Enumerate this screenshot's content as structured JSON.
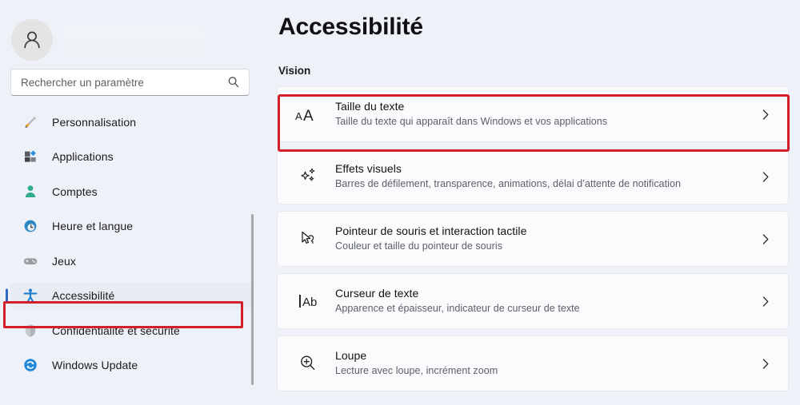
{
  "sidebar": {
    "avatar_icon": "person-avatar-icon",
    "search": {
      "placeholder": "Rechercher un paramètre",
      "value": "",
      "icon": "search-icon"
    },
    "items": [
      {
        "label": "Personnalisation",
        "icon": "paintbrush-icon",
        "selected": false
      },
      {
        "label": "Applications",
        "icon": "apps-grid-icon",
        "selected": false
      },
      {
        "label": "Comptes",
        "icon": "account-person-icon",
        "selected": false
      },
      {
        "label": "Heure et langue",
        "icon": "clock-globe-icon",
        "selected": false
      },
      {
        "label": "Jeux",
        "icon": "gamepad-icon",
        "selected": false
      },
      {
        "label": "Accessibilité",
        "icon": "accessibility-person-icon",
        "selected": true
      },
      {
        "label": "Confidentialité et sécurité",
        "icon": "shield-icon",
        "selected": false
      },
      {
        "label": "Windows Update",
        "icon": "sync-refresh-icon",
        "selected": false
      }
    ]
  },
  "main": {
    "title": "Accessibilité",
    "section": "Vision",
    "cards": [
      {
        "title": "Taille du texte",
        "subtitle": "Taille du texte qui apparaît dans Windows et vos applications",
        "icon": "text-size-aa-icon",
        "chevron": "chevron-right-icon",
        "highlighted": true
      },
      {
        "title": "Effets visuels",
        "subtitle": "Barres de défilement, transparence, animations, délai d’attente de notification",
        "icon": "sparkles-icon",
        "chevron": "chevron-right-icon",
        "highlighted": false
      },
      {
        "title": "Pointeur de souris et interaction tactile",
        "subtitle": "Couleur et taille du pointeur de souris",
        "icon": "mouse-pointer-touch-icon",
        "chevron": "chevron-right-icon",
        "highlighted": false
      },
      {
        "title": "Curseur de texte",
        "subtitle": "Apparence et épaisseur, indicateur de curseur de texte",
        "icon": "text-cursor-icon",
        "chevron": "chevron-right-icon",
        "highlighted": false
      },
      {
        "title": "Loupe",
        "subtitle": "Lecture avec loupe, incrément zoom",
        "icon": "magnifier-plus-icon",
        "chevron": "chevron-right-icon",
        "highlighted": false
      }
    ]
  },
  "annotations": {
    "color": "#d31f29",
    "nav_target": "Accessibilité",
    "card_target": "Taille du texte"
  },
  "colors": {
    "background": "#eef1f7",
    "card": "#fbfbfd",
    "accent": "#2f68c4",
    "annotation": "#d31f29"
  }
}
